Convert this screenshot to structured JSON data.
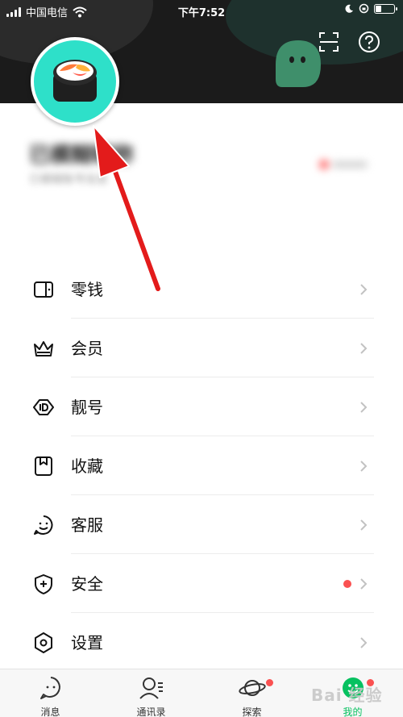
{
  "status_bar": {
    "carrier": "中国电信",
    "time": "下午7:52",
    "signal_icon": "signal-icon",
    "wifi_icon": "wifi-icon",
    "battery_level": 0.35
  },
  "header": {
    "scan_icon": "scan-icon",
    "help_icon": "help-icon",
    "mascot_icon": "mascot-icon"
  },
  "profile": {
    "avatar_icon": "sushi-avatar-icon",
    "name": "已模糊昵称",
    "subtitle": "已模糊账号信息"
  },
  "menu": {
    "items": [
      {
        "label": "零钱",
        "icon": "wallet-icon"
      },
      {
        "label": "会员",
        "icon": "crown-icon"
      },
      {
        "label": "靓号",
        "icon": "id-tag-icon"
      },
      {
        "label": "收藏",
        "icon": "bookmark-icon"
      },
      {
        "label": "客服",
        "icon": "service-icon"
      },
      {
        "label": "安全",
        "icon": "shield-plus-icon",
        "badge": true
      },
      {
        "label": "设置",
        "icon": "settings-hexagon-icon"
      }
    ]
  },
  "tabbar": {
    "tabs": [
      {
        "label": "消息",
        "icon": "message-icon"
      },
      {
        "label": "通讯录",
        "icon": "contacts-icon"
      },
      {
        "label": "探索",
        "icon": "planet-icon",
        "badge": true
      },
      {
        "label": "我的",
        "icon": "me-icon",
        "badge": true,
        "active": true
      }
    ]
  },
  "colors": {
    "header_bg": "#1b1b1b",
    "accent": "#07c160",
    "avatar_bg": "#2ee0c9",
    "badge": "#fa5151",
    "annotation_arrow": "#e31b1b"
  },
  "watermark": "Bai 经验"
}
